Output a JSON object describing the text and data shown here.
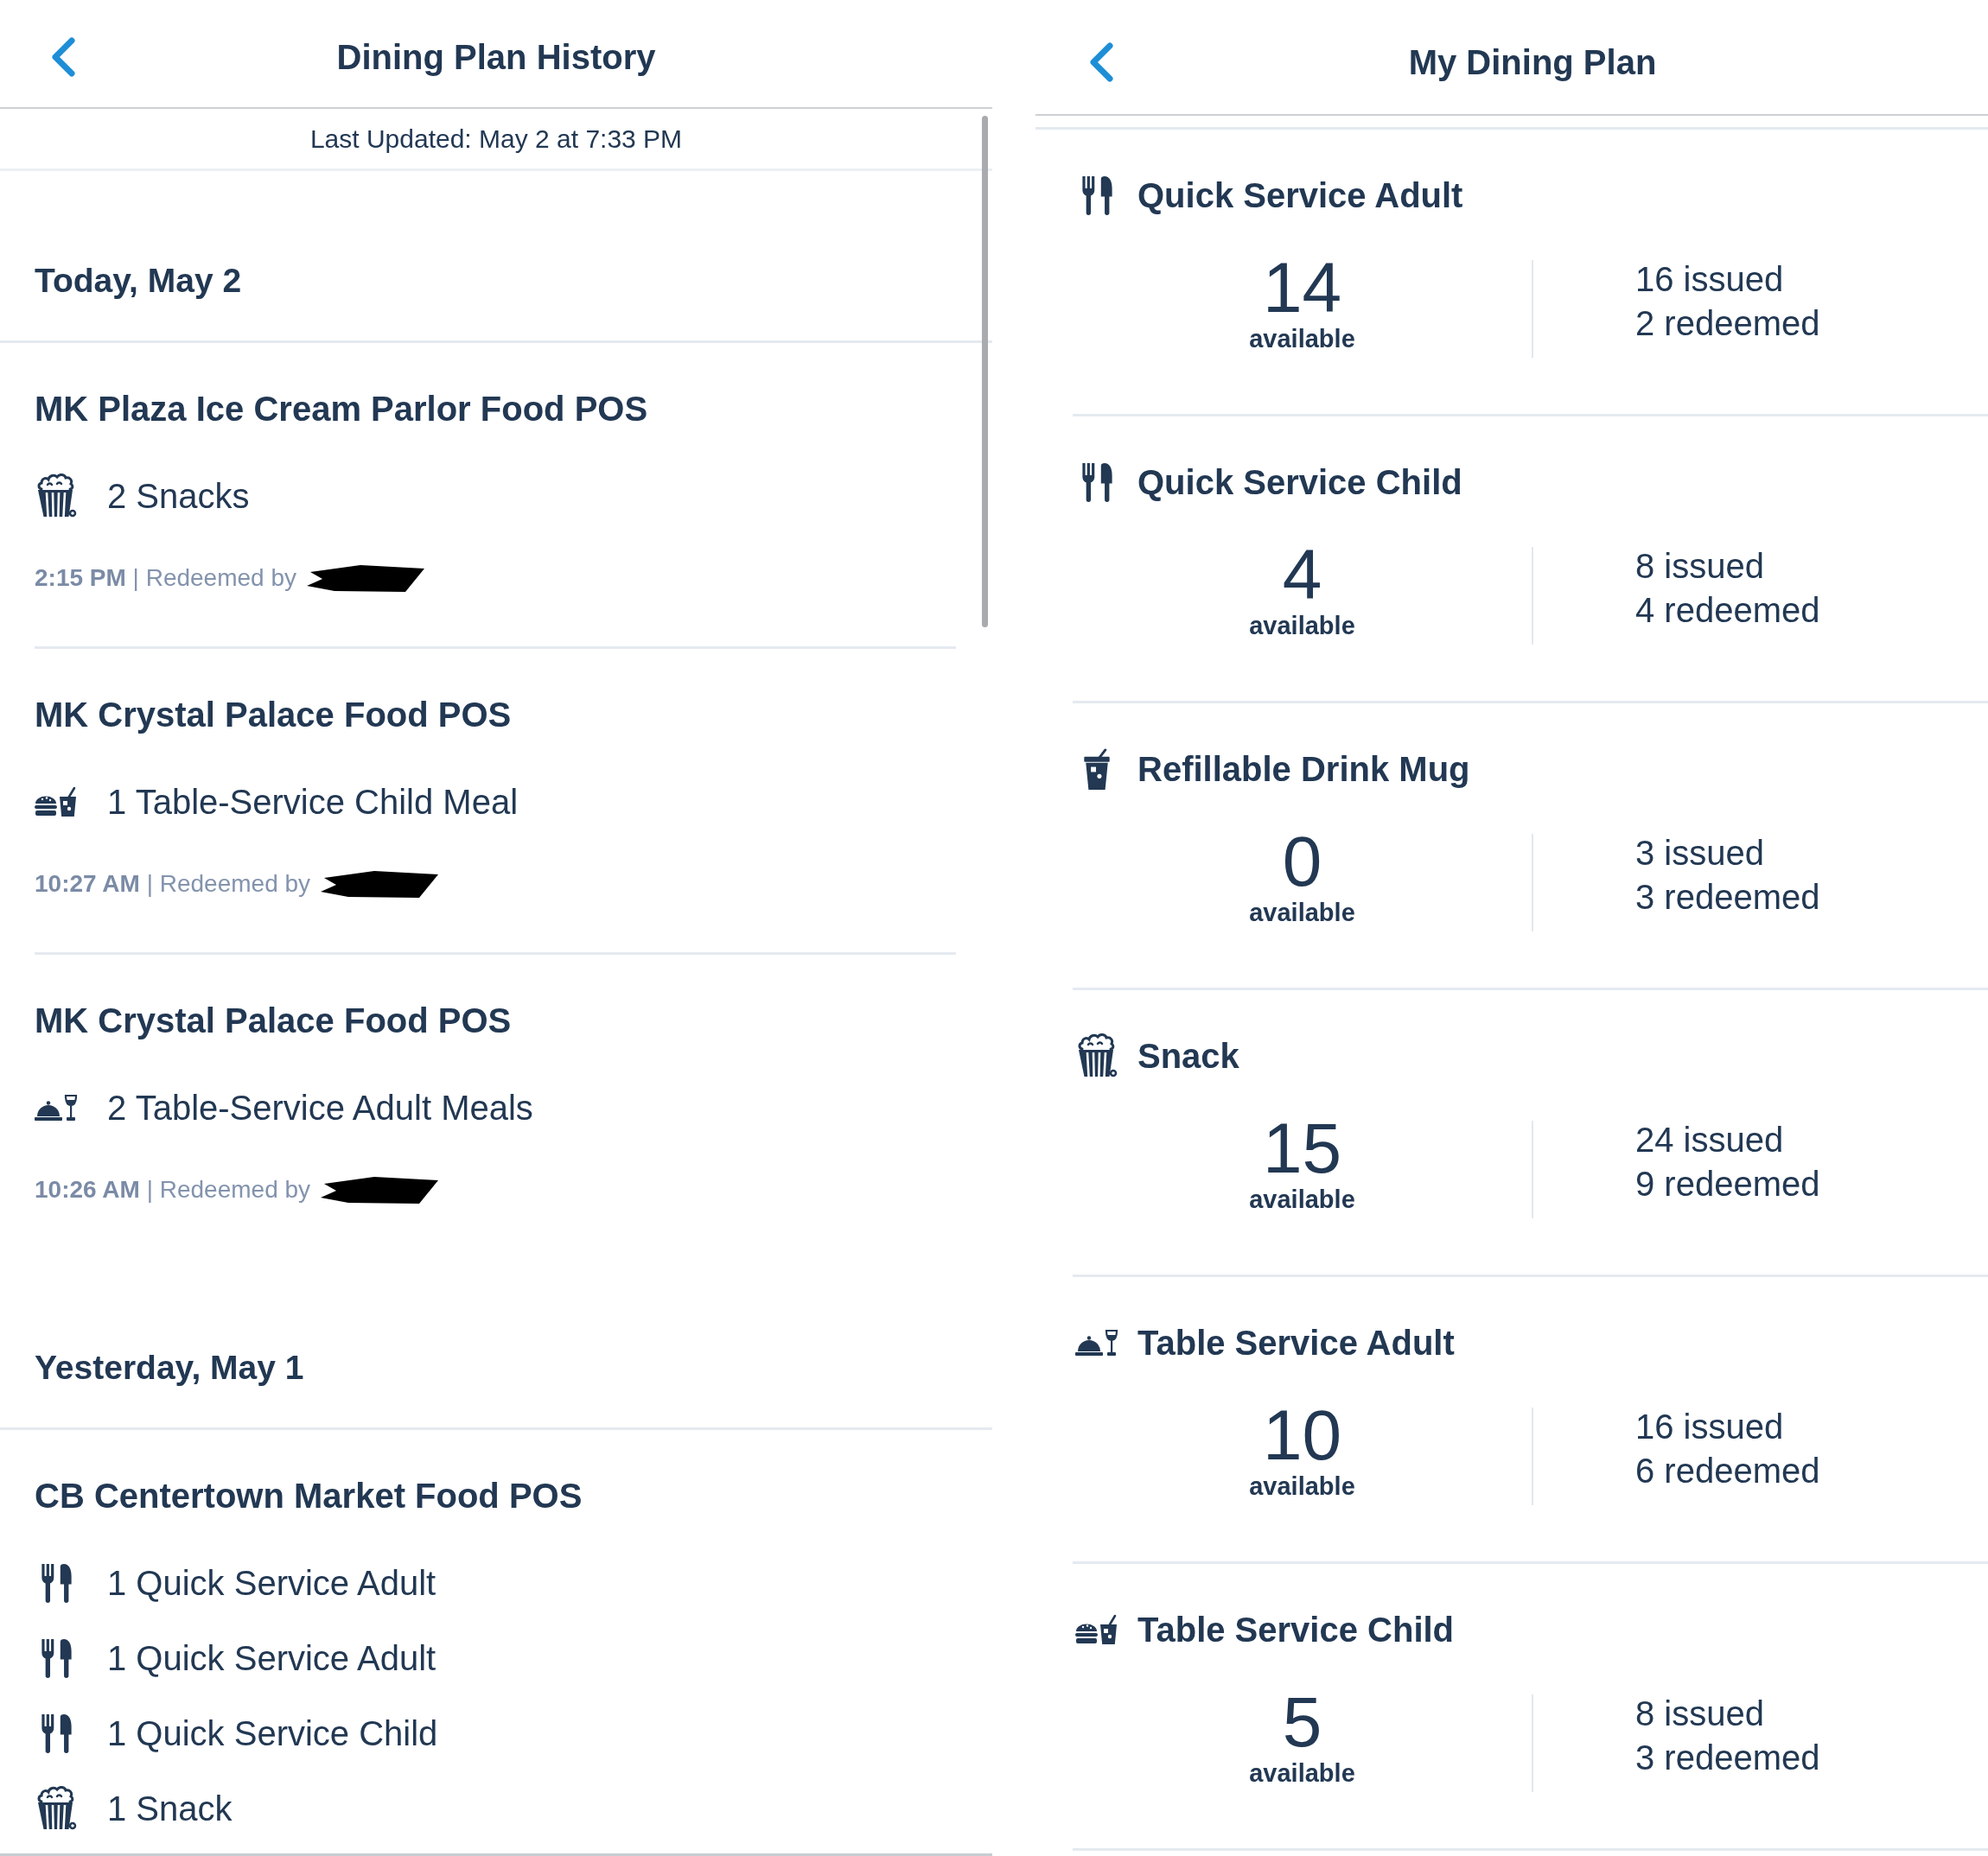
{
  "history": {
    "title": "Dining Plan History",
    "last_updated": "Last Updated: May 2 at 7:33 PM",
    "days": [
      {
        "heading": "Today, May 2",
        "entries": [
          {
            "location": "MK Plaza Ice Cream Parlor Food POS",
            "items": [
              {
                "kind": "snack",
                "label": "2 Snacks"
              }
            ],
            "meta": "**2:15 PM** | Redeemed by"
          },
          {
            "location": "MK Crystal Palace Food POS",
            "items": [
              {
                "kind": "tablechild",
                "label": "1 Table-Service Child Meal"
              }
            ],
            "meta": "**10:27 AM** | Redeemed by"
          },
          {
            "location": "MK Crystal Palace Food POS",
            "items": [
              {
                "kind": "tableadult",
                "label": "2 Table-Service Adult Meals"
              }
            ],
            "meta": "**10:26 AM** | Redeemed by"
          }
        ]
      },
      {
        "heading": "Yesterday, May 1",
        "entries": [
          {
            "location": "CB Centertown Market Food POS",
            "items": [
              {
                "kind": "quickservice",
                "label": "1 Quick Service Adult"
              },
              {
                "kind": "quickservice",
                "label": "1 Quick Service Adult"
              },
              {
                "kind": "quickservice",
                "label": "1 Quick Service Child"
              },
              {
                "kind": "snack",
                "label": "1 Snack"
              }
            ]
          }
        ]
      }
    ]
  },
  "plan": {
    "title": "My Dining Plan",
    "entitlements": [
      {
        "kind": "quickservice",
        "name": "Quick Service Adult",
        "available": "14",
        "available_label": "available",
        "issued": "16 issued",
        "redeemed": "2 redeemed"
      },
      {
        "kind": "quickservice",
        "name": "Quick Service Child",
        "available": "4",
        "available_label": "available",
        "issued": "8 issued",
        "redeemed": "4 redeemed"
      },
      {
        "kind": "mug",
        "name": "Refillable Drink Mug",
        "available": "0",
        "available_label": "available",
        "issued": "3 issued",
        "redeemed": "3 redeemed"
      },
      {
        "kind": "snack",
        "name": "Snack",
        "available": "15",
        "available_label": "available",
        "issued": "24 issued",
        "redeemed": "9 redeemed"
      },
      {
        "kind": "tableadult",
        "name": "Table Service Adult",
        "available": "10",
        "available_label": "available",
        "issued": "16 issued",
        "redeemed": "6 redeemed"
      },
      {
        "kind": "tablechild",
        "name": "Table Service Child",
        "available": "5",
        "available_label": "available",
        "issued": "8 issued",
        "redeemed": "3 redeemed"
      }
    ]
  }
}
